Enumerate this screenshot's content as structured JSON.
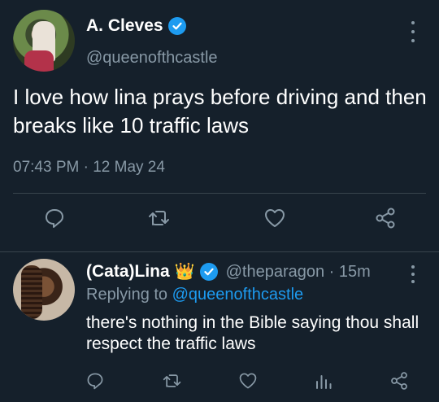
{
  "main_tweet": {
    "display_name": "A. Cleves",
    "handle": "@queenofthcastle",
    "text": "I love how lina prays before driving and then breaks like 10 traffic laws",
    "timestamp": "07:43 PM · 12 May 24",
    "icons": [
      "more-icon",
      "reply-icon",
      "retweet-icon",
      "like-icon",
      "share-icon"
    ]
  },
  "reply": {
    "display_name": "(Cata)Lina",
    "emoji": "👑",
    "handle_time": "@theparagon · 15m",
    "replying_label": "Replying to ",
    "replying_to": "@queenofthcastle",
    "text": "there's nothing in the Bible saying thou shall respect the traffic laws",
    "icons": [
      "more-icon",
      "reply-icon",
      "retweet-icon",
      "like-icon",
      "analytics-icon",
      "share-icon"
    ]
  },
  "colors": {
    "background": "#15202b",
    "accent": "#1d9bf0",
    "muted": "#8899a6",
    "divider": "#38444d"
  }
}
